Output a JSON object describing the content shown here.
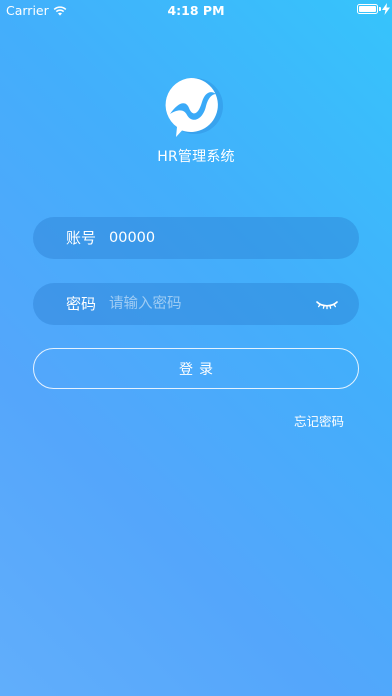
{
  "status_bar": {
    "carrier": "Carrier",
    "time": "4:18 PM",
    "battery_level": 1.0,
    "icons": [
      "wifi-icon",
      "battery-icon",
      "charging-icon"
    ]
  },
  "app": {
    "title": "HR管理系统",
    "logo_icon": "speech-bubble-logo-icon"
  },
  "form": {
    "account_label": "账号",
    "account_value": "00000",
    "password_label": "密码",
    "password_placeholder": "请输入密码",
    "password_visibility_icon": "eye-closed-icon",
    "login_label": "登录",
    "forgot_label": "忘记密码"
  },
  "colors": {
    "background_top": "#36c4fb",
    "background_bottom": "#61aefb",
    "field_background": "#2878cd",
    "text": "#ffffff"
  }
}
